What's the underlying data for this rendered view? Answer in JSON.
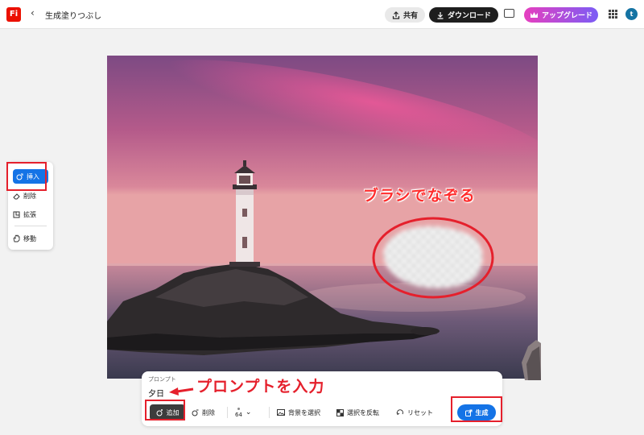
{
  "app": {
    "logo_text": "Fi",
    "title": "生成塗りつぶし"
  },
  "header": {
    "share_label": "共有",
    "download_label": "ダウンロード",
    "upgrade_label": "アップグレード",
    "avatar_initial": "t"
  },
  "left_panel": {
    "tools": [
      {
        "label": "挿入",
        "icon": "insert-icon",
        "active": true
      },
      {
        "label": "削除",
        "icon": "eraser-icon"
      },
      {
        "label": "拡張",
        "icon": "expand-icon"
      },
      {
        "label": "移動",
        "icon": "hand-icon"
      }
    ]
  },
  "prompt": {
    "label": "プロンプト",
    "value": "夕日"
  },
  "toolbar": {
    "add_label": "追加",
    "remove_label": "削除",
    "brush_size": "64",
    "select_bg_label": "背景を選択",
    "invert_label": "選択を反転",
    "reset_label": "リセット",
    "generate_label": "生成"
  },
  "annotations": {
    "brush": "ブラシでなぞる",
    "prompt": "プロンプトを入力"
  },
  "colors": {
    "accent": "#1473e6",
    "annotation_red": "#e5202c",
    "upgrade_gradient_start": "#e63fbf",
    "upgrade_gradient_end": "#7b5cf5",
    "logo": "#eb1000"
  }
}
